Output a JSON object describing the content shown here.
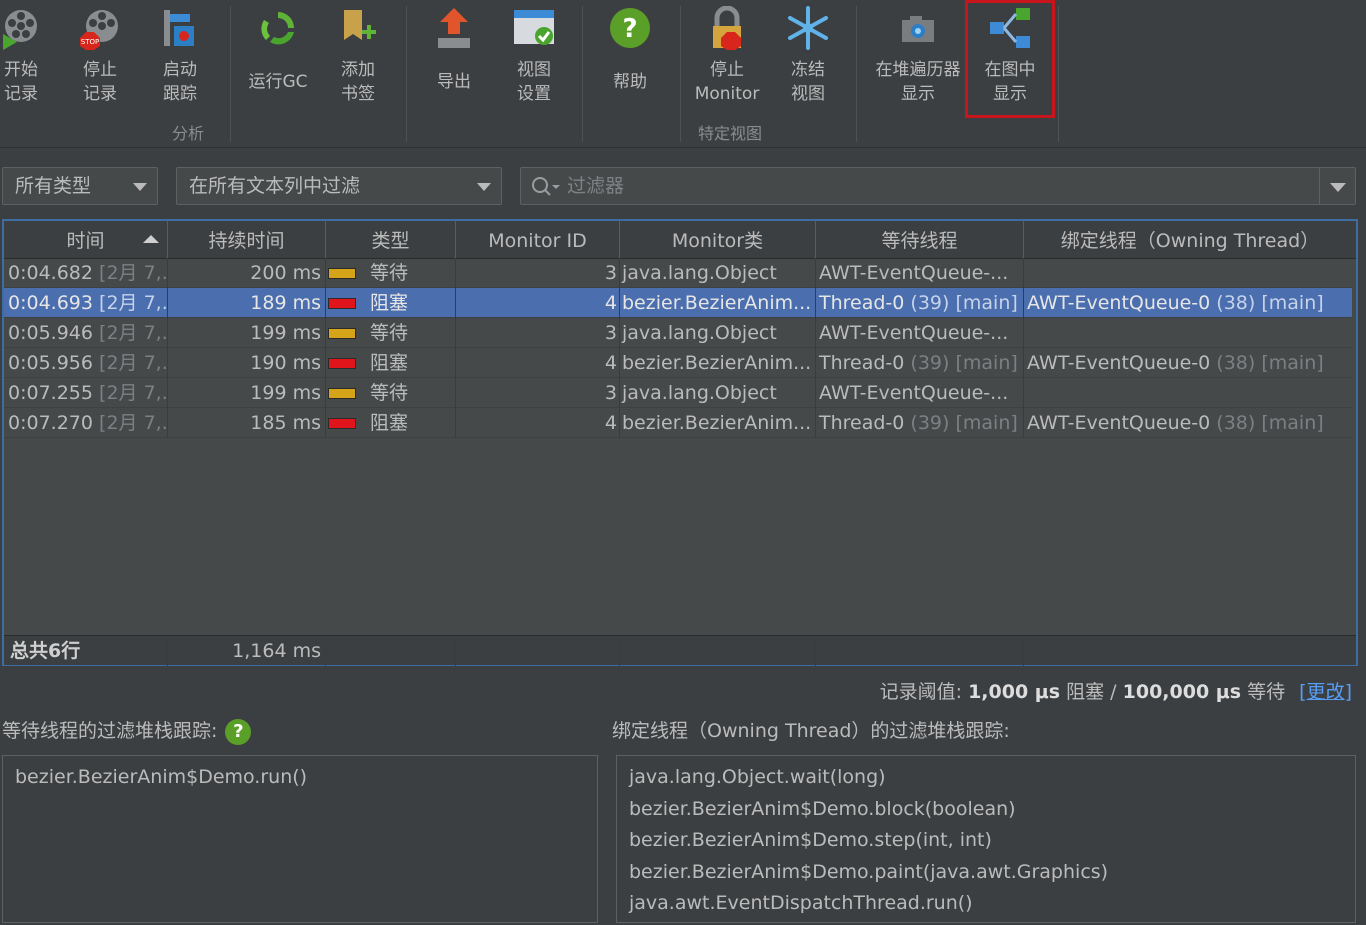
{
  "toolbar": {
    "start_record": "开始\n记录",
    "stop_record": "停止\n记录",
    "start_trace": "启动\n跟踪",
    "run_gc": "运行GC",
    "add_bookmark": "添加\n书签",
    "export": "导出",
    "view_settings": "视图\n设置",
    "help": "帮助",
    "stop_monitor": "停止\nMonitor",
    "freeze_view": "冻结\n视图",
    "show_in_heap_walker": "在堆遍历器\n显示",
    "show_in_graph": "在图中\n显示",
    "group_analysis": "分析",
    "group_view": "特定视图",
    "stop_badge": "STOP"
  },
  "filters": {
    "type_combo": "所有类型",
    "column_combo": "在所有文本列中过滤",
    "search_placeholder": "过滤器"
  },
  "table": {
    "columns": [
      "时间",
      "持续时间",
      "类型",
      "Monitor ID",
      "Monitor类",
      "等待线程",
      "绑定线程（Owning Thread）"
    ],
    "rows": [
      {
        "time": "0:04.682",
        "date": "[2月 7,...",
        "duration": "200 ms",
        "type": "等待",
        "color": "#d6a418",
        "id": "3",
        "cls": "java.lang.Object",
        "wait": "AWT-EventQueue-...",
        "wait_dim": "",
        "own": "",
        "own_dim": ""
      },
      {
        "time": "0:04.693",
        "date": "[2月 7,...",
        "duration": "189 ms",
        "type": "阻塞",
        "color": "#e0151b",
        "id": "4",
        "cls": "bezier.BezierAnim...",
        "wait": "Thread-0",
        "wait_dim": " (39) [main]",
        "own": "AWT-EventQueue-0",
        "own_dim": " (38) [main]"
      },
      {
        "time": "0:05.946",
        "date": "[2月 7,...",
        "duration": "199 ms",
        "type": "等待",
        "color": "#d6a418",
        "id": "3",
        "cls": "java.lang.Object",
        "wait": "AWT-EventQueue-...",
        "wait_dim": "",
        "own": "",
        "own_dim": ""
      },
      {
        "time": "0:05.956",
        "date": "[2月 7,...",
        "duration": "190 ms",
        "type": "阻塞",
        "color": "#e0151b",
        "id": "4",
        "cls": "bezier.BezierAnim...",
        "wait": "Thread-0",
        "wait_dim": " (39) [main]",
        "own": "AWT-EventQueue-0",
        "own_dim": " (38) [main]"
      },
      {
        "time": "0:07.255",
        "date": "[2月 7,...",
        "duration": "199 ms",
        "type": "等待",
        "color": "#d6a418",
        "id": "3",
        "cls": "java.lang.Object",
        "wait": "AWT-EventQueue-...",
        "wait_dim": "",
        "own": "",
        "own_dim": ""
      },
      {
        "time": "0:07.270",
        "date": "[2月 7,...",
        "duration": "185 ms",
        "type": "阻塞",
        "color": "#e0151b",
        "id": "4",
        "cls": "bezier.BezierAnim...",
        "wait": "Thread-0",
        "wait_dim": " (39) [main]",
        "own": "AWT-EventQueue-0",
        "own_dim": " (38) [main]"
      }
    ],
    "footer_rows": "总共6行",
    "footer_duration": "1,164 ms"
  },
  "threshold": {
    "prefix": "记录阈值: ",
    "block_value": "1,000 μs",
    "block_label": " 阻塞 / ",
    "wait_value": "100,000 μs",
    "wait_label": " 等待 ",
    "change_link": "[更改]"
  },
  "stacks": {
    "waiting_label": "等待线程的过滤堆栈跟踪:",
    "owning_label": "绑定线程（Owning Thread）的过滤堆栈跟踪:",
    "waiting_help": "?",
    "waiting": [
      "bezier.BezierAnim$Demo.run()"
    ],
    "owning": [
      "java.lang.Object.wait(long)",
      "bezier.BezierAnim$Demo.block(boolean)",
      "bezier.BezierAnim$Demo.step(int, int)",
      "bezier.BezierAnim$Demo.paint(java.awt.Graphics)",
      "java.awt.EventDispatchThread.run()"
    ]
  },
  "colors": {
    "background": "#3c3f41",
    "selection": "#4b6eaf",
    "waiting": "#d6a418",
    "blocked": "#e0151b",
    "highlight_border": "#c8151b",
    "link": "#589df6"
  }
}
